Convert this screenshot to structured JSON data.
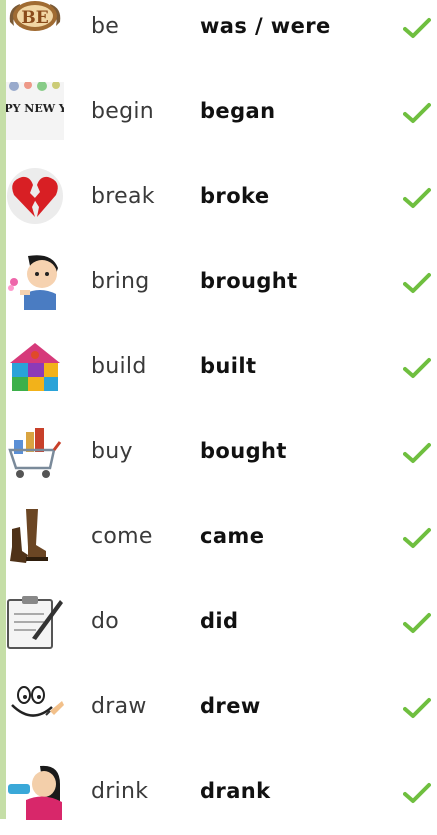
{
  "verbs": [
    {
      "base": "be",
      "past": "was / were",
      "icon": "be-badge-icon",
      "badge_text": "BE"
    },
    {
      "base": "begin",
      "past": "began",
      "icon": "happy-new-year-icon",
      "badge_text": "HAPPY NEW YEAR"
    },
    {
      "base": "break",
      "past": "broke",
      "icon": "broken-heart-icon"
    },
    {
      "base": "bring",
      "past": "brought",
      "icon": "boy-bringing-flowers-icon"
    },
    {
      "base": "build",
      "past": "built",
      "icon": "puzzle-house-icon"
    },
    {
      "base": "buy",
      "past": "bought",
      "icon": "shopping-cart-icon"
    },
    {
      "base": "come",
      "past": "came",
      "icon": "walking-boots-icon"
    },
    {
      "base": "do",
      "past": "did",
      "icon": "clipboard-pen-icon"
    },
    {
      "base": "draw",
      "past": "drew",
      "icon": "drawing-face-icon"
    },
    {
      "base": "drink",
      "past": "drank",
      "icon": "girl-drinking-icon"
    }
  ],
  "check_icon": "checkmark-icon",
  "colors": {
    "accent_bar": "#c5dea7",
    "check": "#6fbf3f"
  }
}
